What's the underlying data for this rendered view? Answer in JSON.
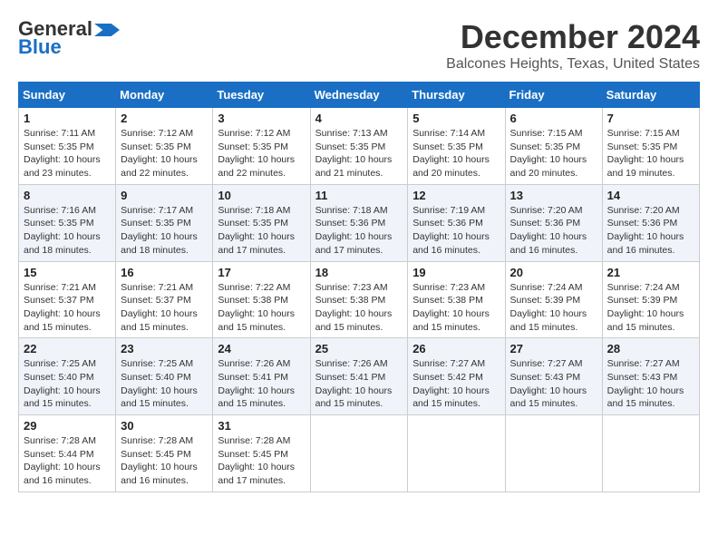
{
  "header": {
    "logo_line1": "General",
    "logo_line2": "Blue",
    "month_title": "December 2024",
    "location": "Balcones Heights, Texas, United States"
  },
  "weekdays": [
    "Sunday",
    "Monday",
    "Tuesday",
    "Wednesday",
    "Thursday",
    "Friday",
    "Saturday"
  ],
  "weeks": [
    [
      {
        "day": "1",
        "info": "Sunrise: 7:11 AM\nSunset: 5:35 PM\nDaylight: 10 hours\nand 23 minutes."
      },
      {
        "day": "2",
        "info": "Sunrise: 7:12 AM\nSunset: 5:35 PM\nDaylight: 10 hours\nand 22 minutes."
      },
      {
        "day": "3",
        "info": "Sunrise: 7:12 AM\nSunset: 5:35 PM\nDaylight: 10 hours\nand 22 minutes."
      },
      {
        "day": "4",
        "info": "Sunrise: 7:13 AM\nSunset: 5:35 PM\nDaylight: 10 hours\nand 21 minutes."
      },
      {
        "day": "5",
        "info": "Sunrise: 7:14 AM\nSunset: 5:35 PM\nDaylight: 10 hours\nand 20 minutes."
      },
      {
        "day": "6",
        "info": "Sunrise: 7:15 AM\nSunset: 5:35 PM\nDaylight: 10 hours\nand 20 minutes."
      },
      {
        "day": "7",
        "info": "Sunrise: 7:15 AM\nSunset: 5:35 PM\nDaylight: 10 hours\nand 19 minutes."
      }
    ],
    [
      {
        "day": "8",
        "info": "Sunrise: 7:16 AM\nSunset: 5:35 PM\nDaylight: 10 hours\nand 18 minutes."
      },
      {
        "day": "9",
        "info": "Sunrise: 7:17 AM\nSunset: 5:35 PM\nDaylight: 10 hours\nand 18 minutes."
      },
      {
        "day": "10",
        "info": "Sunrise: 7:18 AM\nSunset: 5:35 PM\nDaylight: 10 hours\nand 17 minutes."
      },
      {
        "day": "11",
        "info": "Sunrise: 7:18 AM\nSunset: 5:36 PM\nDaylight: 10 hours\nand 17 minutes."
      },
      {
        "day": "12",
        "info": "Sunrise: 7:19 AM\nSunset: 5:36 PM\nDaylight: 10 hours\nand 16 minutes."
      },
      {
        "day": "13",
        "info": "Sunrise: 7:20 AM\nSunset: 5:36 PM\nDaylight: 10 hours\nand 16 minutes."
      },
      {
        "day": "14",
        "info": "Sunrise: 7:20 AM\nSunset: 5:36 PM\nDaylight: 10 hours\nand 16 minutes."
      }
    ],
    [
      {
        "day": "15",
        "info": "Sunrise: 7:21 AM\nSunset: 5:37 PM\nDaylight: 10 hours\nand 15 minutes."
      },
      {
        "day": "16",
        "info": "Sunrise: 7:21 AM\nSunset: 5:37 PM\nDaylight: 10 hours\nand 15 minutes."
      },
      {
        "day": "17",
        "info": "Sunrise: 7:22 AM\nSunset: 5:38 PM\nDaylight: 10 hours\nand 15 minutes."
      },
      {
        "day": "18",
        "info": "Sunrise: 7:23 AM\nSunset: 5:38 PM\nDaylight: 10 hours\nand 15 minutes."
      },
      {
        "day": "19",
        "info": "Sunrise: 7:23 AM\nSunset: 5:38 PM\nDaylight: 10 hours\nand 15 minutes."
      },
      {
        "day": "20",
        "info": "Sunrise: 7:24 AM\nSunset: 5:39 PM\nDaylight: 10 hours\nand 15 minutes."
      },
      {
        "day": "21",
        "info": "Sunrise: 7:24 AM\nSunset: 5:39 PM\nDaylight: 10 hours\nand 15 minutes."
      }
    ],
    [
      {
        "day": "22",
        "info": "Sunrise: 7:25 AM\nSunset: 5:40 PM\nDaylight: 10 hours\nand 15 minutes."
      },
      {
        "day": "23",
        "info": "Sunrise: 7:25 AM\nSunset: 5:40 PM\nDaylight: 10 hours\nand 15 minutes."
      },
      {
        "day": "24",
        "info": "Sunrise: 7:26 AM\nSunset: 5:41 PM\nDaylight: 10 hours\nand 15 minutes."
      },
      {
        "day": "25",
        "info": "Sunrise: 7:26 AM\nSunset: 5:41 PM\nDaylight: 10 hours\nand 15 minutes."
      },
      {
        "day": "26",
        "info": "Sunrise: 7:27 AM\nSunset: 5:42 PM\nDaylight: 10 hours\nand 15 minutes."
      },
      {
        "day": "27",
        "info": "Sunrise: 7:27 AM\nSunset: 5:43 PM\nDaylight: 10 hours\nand 15 minutes."
      },
      {
        "day": "28",
        "info": "Sunrise: 7:27 AM\nSunset: 5:43 PM\nDaylight: 10 hours\nand 15 minutes."
      }
    ],
    [
      {
        "day": "29",
        "info": "Sunrise: 7:28 AM\nSunset: 5:44 PM\nDaylight: 10 hours\nand 16 minutes."
      },
      {
        "day": "30",
        "info": "Sunrise: 7:28 AM\nSunset: 5:45 PM\nDaylight: 10 hours\nand 16 minutes."
      },
      {
        "day": "31",
        "info": "Sunrise: 7:28 AM\nSunset: 5:45 PM\nDaylight: 10 hours\nand 17 minutes."
      },
      {
        "day": "",
        "info": ""
      },
      {
        "day": "",
        "info": ""
      },
      {
        "day": "",
        "info": ""
      },
      {
        "day": "",
        "info": ""
      }
    ]
  ]
}
